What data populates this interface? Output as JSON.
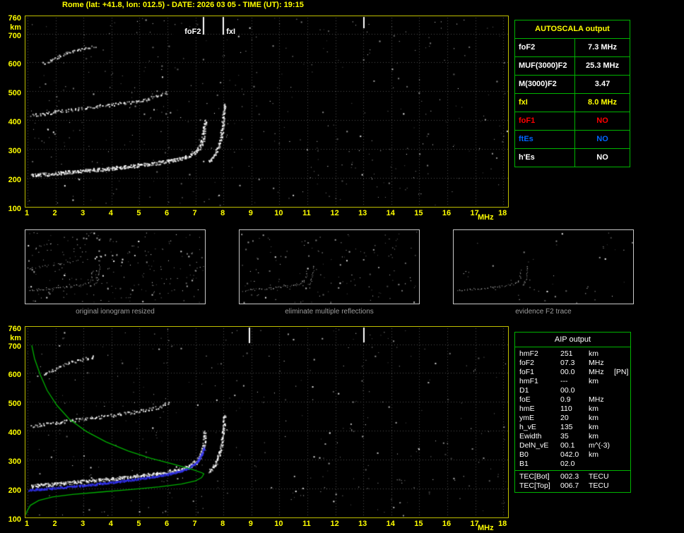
{
  "title": "Rome (lat: +41.8, lon: 012.5) - DATE: 2026 03 05 - TIME (UT): 19:15",
  "colors": {
    "background": "#000000",
    "axis_text": "#ffff00",
    "plot_border": "#bdbd00",
    "grid": "#4f4f4f",
    "trace_white": "#ffffff",
    "profile_green": "#00bb00",
    "trace_blue": "#3333ee",
    "table_border": "#00b400",
    "caption_gray": "#9c9c9c"
  },
  "axes": {
    "x_ticks": [
      1,
      2,
      3,
      4,
      5,
      6,
      7,
      8,
      9,
      10,
      11,
      12,
      13,
      14,
      15,
      16,
      17,
      18
    ],
    "x_unit": "MHz",
    "y_ticks": [
      760,
      700,
      600,
      500,
      400,
      300,
      200,
      100
    ],
    "y_unit": "km",
    "x_range": [
      1,
      18
    ],
    "y_range": [
      100,
      760
    ]
  },
  "autoscala": {
    "header": "AUTOSCALA output",
    "rows": [
      {
        "label": "foF2",
        "value": "7.3 MHz",
        "color": "#ffffff"
      },
      {
        "label": "MUF(3000)F2",
        "value": "25.3 MHz",
        "color": "#ffffff"
      },
      {
        "label": "M(3000)F2",
        "value": "3.47",
        "color": "#ffffff"
      },
      {
        "label": "fxI",
        "value": "8.0 MHz",
        "color": "#ffff00"
      },
      {
        "label": "foF1",
        "value": "NO",
        "color": "#ff0000"
      },
      {
        "label": "ftEs",
        "value": "NO",
        "color": "#0066ff"
      },
      {
        "label": "h'Es",
        "value": "NO",
        "color": "#ffffff"
      }
    ]
  },
  "aip": {
    "header": "AIP output",
    "rows": [
      {
        "label": "hmF2",
        "value": "251",
        "unit": "km",
        "note": ""
      },
      {
        "label": "foF2",
        "value": "07.3",
        "unit": "MHz",
        "note": ""
      },
      {
        "label": "foF1",
        "value": "00.0",
        "unit": "MHz",
        "note": "[PN]"
      },
      {
        "label": "hmF1",
        "value": "---",
        "unit": "km",
        "note": ""
      },
      {
        "label": "D1",
        "value": "00.0",
        "unit": "",
        "note": ""
      },
      {
        "label": "foE",
        "value": "0.9",
        "unit": "MHz",
        "note": ""
      },
      {
        "label": "hmE",
        "value": "110",
        "unit": "km",
        "note": ""
      },
      {
        "label": "ymE",
        "value": "20",
        "unit": "km",
        "note": ""
      },
      {
        "label": "h_vE",
        "value": "135",
        "unit": "km",
        "note": ""
      },
      {
        "label": "Ewidth",
        "value": "35",
        "unit": "km",
        "note": ""
      },
      {
        "label": "DelN_vE",
        "value": "00.1",
        "unit": "m^(-3)",
        "note": ""
      },
      {
        "label": "B0",
        "value": "042.0",
        "unit": "km",
        "note": ""
      },
      {
        "label": "B1",
        "value": "02.0",
        "unit": "",
        "note": ""
      }
    ],
    "tec_rows": [
      {
        "label": "TEC[Bot]",
        "value": "002.3",
        "unit": "TECU",
        "note": ""
      },
      {
        "label": "TEC[Top]",
        "value": "006.7",
        "unit": "TECU",
        "note": ""
      }
    ]
  },
  "chart_data": {
    "type": "scatter",
    "xlabel": "MHz",
    "ylabel": "km",
    "xlim": [
      1,
      18
    ],
    "ylim": [
      100,
      760
    ],
    "grid": true,
    "traces": {
      "f2": {
        "name": "F2 layer O-mode trace",
        "color": "#ffffff",
        "size": 2,
        "density": 1.4,
        "jitter": 2.4,
        "points": [
          [
            1.12,
            210
          ],
          [
            1.6,
            214
          ],
          [
            2.2,
            219
          ],
          [
            3.0,
            226
          ],
          [
            3.8,
            233
          ],
          [
            4.6,
            241
          ],
          [
            5.4,
            250
          ],
          [
            6.0,
            259
          ],
          [
            6.5,
            269
          ],
          [
            6.8,
            280
          ],
          [
            7.0,
            293
          ],
          [
            7.15,
            310
          ],
          [
            7.25,
            335
          ],
          [
            7.3,
            365
          ],
          [
            7.33,
            400
          ]
        ]
      },
      "f2x": {
        "name": "F2 layer X-mode cusp",
        "color": "#ffffff",
        "size": 2,
        "density": 1.2,
        "jitter": 1.8,
        "points": [
          [
            7.45,
            258
          ],
          [
            7.6,
            272
          ],
          [
            7.72,
            290
          ],
          [
            7.82,
            312
          ],
          [
            7.9,
            340
          ],
          [
            7.96,
            378
          ],
          [
            8.0,
            425
          ],
          [
            8.02,
            458
          ]
        ]
      },
      "second_hop": {
        "name": "second reflection trace",
        "color": "#ffffff",
        "size": 2,
        "density": 0.6,
        "jitter": 2.2,
        "points": [
          [
            1.1,
            418
          ],
          [
            1.9,
            428
          ],
          [
            2.7,
            439
          ],
          [
            3.5,
            449
          ],
          [
            4.3,
            459
          ],
          [
            5.0,
            470
          ],
          [
            5.6,
            482
          ],
          [
            6.0,
            498
          ]
        ]
      },
      "high_partial": {
        "name": "high multiple partial trace",
        "color": "#ffffff",
        "size": 2,
        "density": 0.55,
        "jitter": 2.0,
        "points": [
          [
            1.55,
            596
          ],
          [
            2.0,
            618
          ],
          [
            2.5,
            637
          ],
          [
            3.0,
            650
          ],
          [
            3.4,
            659
          ]
        ]
      },
      "blue": {
        "name": "scaled F2 trace (blue)",
        "color": "#3333ee",
        "size": 2,
        "density": 1.8,
        "jitter": 1.4,
        "points": [
          [
            1.02,
            196
          ],
          [
            1.8,
            202
          ],
          [
            2.6,
            209
          ],
          [
            3.4,
            216
          ],
          [
            4.2,
            225
          ],
          [
            5.0,
            235
          ],
          [
            5.8,
            247
          ],
          [
            6.4,
            260
          ],
          [
            6.8,
            275
          ],
          [
            7.05,
            294
          ],
          [
            7.2,
            317
          ],
          [
            7.3,
            345
          ]
        ]
      },
      "green_profile": {
        "name": "electron density profile (green)",
        "color": "#00bb00",
        "points": [
          [
            1.15,
            696
          ],
          [
            1.25,
            650
          ],
          [
            1.45,
            595
          ],
          [
            1.7,
            540
          ],
          [
            2.05,
            488
          ],
          [
            2.5,
            440
          ],
          [
            3.1,
            398
          ],
          [
            3.8,
            362
          ],
          [
            4.6,
            330
          ],
          [
            5.4,
            305
          ],
          [
            6.2,
            285
          ],
          [
            6.9,
            266
          ],
          [
            7.25,
            254
          ],
          [
            7.3,
            251
          ],
          [
            7.22,
            238
          ],
          [
            7.0,
            227
          ],
          [
            6.5,
            216
          ],
          [
            5.7,
            206
          ],
          [
            4.7,
            197
          ],
          [
            3.6,
            188
          ],
          [
            2.6,
            180
          ],
          [
            1.9,
            171
          ],
          [
            1.4,
            159
          ],
          [
            1.1,
            142
          ],
          [
            0.97,
            120
          ],
          [
            0.95,
            110
          ]
        ]
      }
    },
    "top_plot": {
      "noise_count": 380,
      "noise_seed": 101,
      "traces": [
        "f2",
        "f2x",
        "second_hop",
        "high_partial"
      ],
      "artifacts_mhz": [
        13.0
      ],
      "markers": [
        {
          "label": "foF2",
          "mhz": 7.3,
          "side": "left"
        },
        {
          "label": "fxI",
          "mhz": 8.0,
          "side": "right"
        }
      ]
    },
    "bottom_plot": {
      "noise_count": 320,
      "noise_seed": 202,
      "traces": [
        "f2",
        "f2x",
        "second_hop",
        "high_partial"
      ],
      "blue_trace": "blue",
      "green_profile": "green_profile",
      "artifacts_mhz": [
        8.9,
        13.0
      ]
    },
    "panels": [
      {
        "caption": "original ionogram resized",
        "noise_count": 240,
        "noise_seed": 31,
        "traces": [
          "f2",
          "f2x",
          "second_hop",
          "high_partial"
        ]
      },
      {
        "caption": "eliminate multiple reflections",
        "noise_count": 140,
        "noise_seed": 32,
        "traces": [
          "f2",
          "f2x"
        ]
      },
      {
        "caption": "evidence F2 trace",
        "noise_count": 45,
        "noise_seed": 33,
        "traces": [
          "f2",
          "f2x"
        ]
      }
    ]
  }
}
